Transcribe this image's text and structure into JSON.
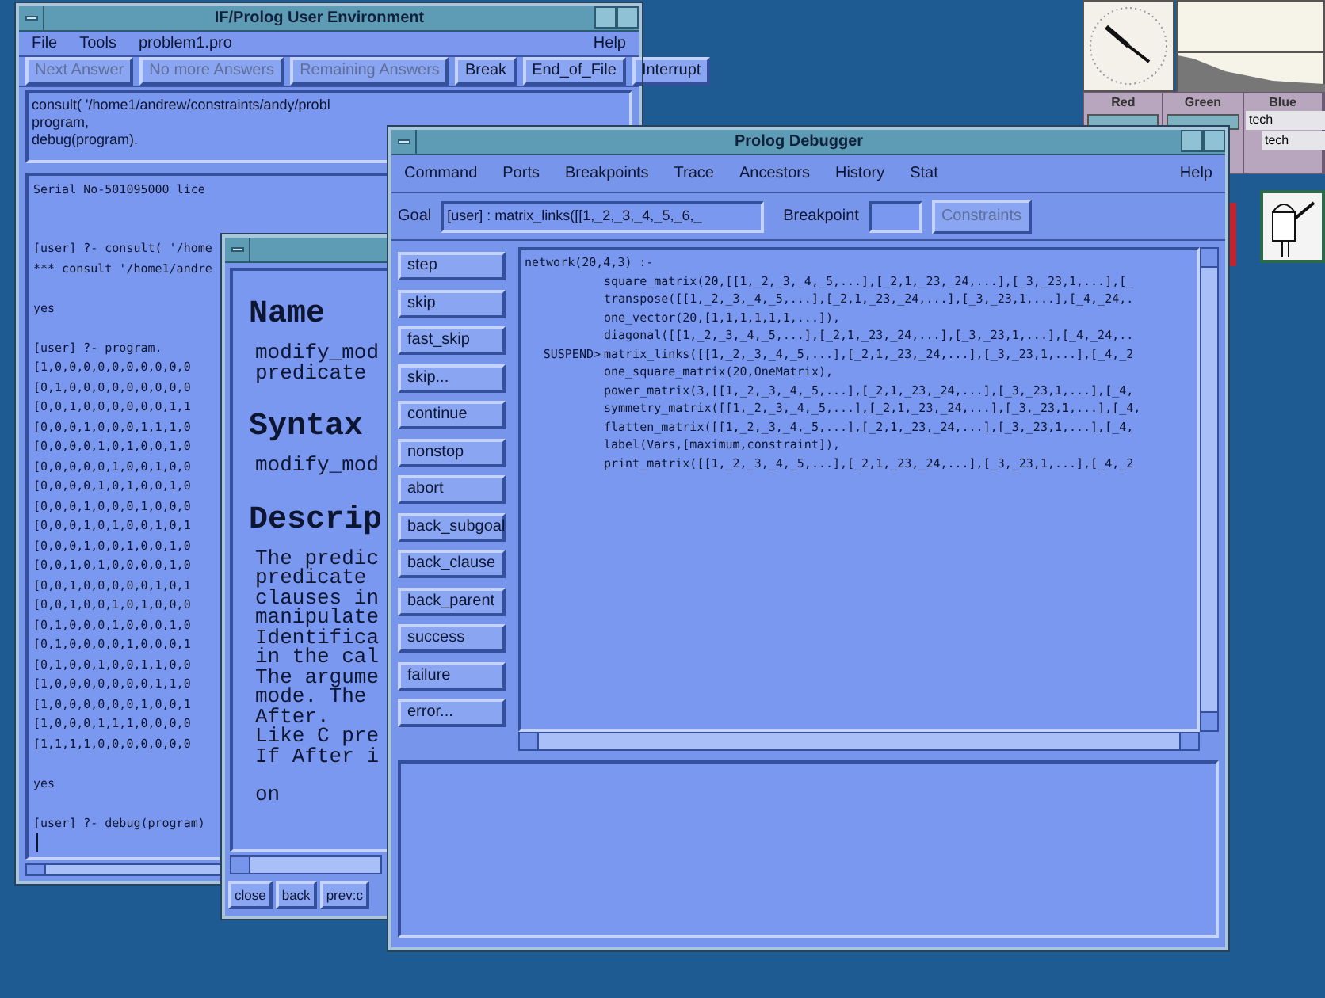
{
  "user_environment": {
    "title": "IF/Prolog User Environment",
    "menu": [
      "File",
      "Tools",
      "problem1.pro"
    ],
    "help_menu": "Help",
    "buttons": [
      {
        "label": "Next Answer",
        "disabled": true
      },
      {
        "label": "No more Answers",
        "disabled": true
      },
      {
        "label": "Remaining Answers",
        "disabled": true
      },
      {
        "label": "Break",
        "disabled": false
      },
      {
        "label": "End_of_File",
        "disabled": false
      },
      {
        "label": "Interrupt",
        "disabled": false
      }
    ],
    "query_lines": [
      "consult( '/home1/andrew/constraints/andy/probl",
      "program,",
      "debug(program)."
    ],
    "console_blocks": [
      [
        "Serial No-501095000 lice"
      ],
      [
        "[user] ?- consult( '/home",
        "*** consult '/home1/andre"
      ],
      [
        "yes"
      ],
      [
        "[user] ?- program.",
        "[1,0,0,0,0,0,0,0,0,0,0",
        "[0,1,0,0,0,0,0,0,0,0,0",
        "[0,0,1,0,0,0,0,0,0,1,1",
        "[0,0,0,1,0,0,0,1,1,1,0",
        "[0,0,0,0,1,0,1,0,0,1,0",
        "[0,0,0,0,0,1,0,0,1,0,0",
        "[0,0,0,0,1,0,1,0,0,1,0",
        "[0,0,0,1,0,0,0,1,0,0,0",
        "[0,0,0,1,0,1,0,0,1,0,1",
        "[0,0,0,1,0,0,1,0,0,1,0",
        "[0,0,1,0,1,0,0,0,0,1,0",
        "[0,0,1,0,0,0,0,0,1,0,1",
        "[0,0,1,0,0,1,0,1,0,0,0",
        "[0,1,0,0,0,1,0,0,0,1,0",
        "[0,1,0,0,0,0,1,0,0,0,1",
        "[0,1,0,0,1,0,0,1,1,0,0",
        "[1,0,0,0,0,0,0,0,1,1,0",
        "[1,0,0,0,0,0,0,1,0,0,1",
        "[1,0,0,0,1,1,1,0,0,0,0",
        "[1,1,1,1,0,0,0,0,0,0,0"
      ],
      [
        "yes"
      ],
      [
        "[user] ?- debug(program)"
      ]
    ]
  },
  "help_window": {
    "sections": [
      {
        "heading": "Name",
        "paragraphs": [
          [
            "modify_mod",
            "predicate"
          ]
        ]
      },
      {
        "heading": "Syntax",
        "paragraphs": [
          [
            "modify_mod"
          ]
        ]
      },
      {
        "heading": "Descrip",
        "paragraphs": [
          [
            "The predic",
            "predicate",
            "clauses in",
            "manipulate",
            "Identifica",
            "in the cal",
            "The argume",
            "mode. The",
            "After.",
            "Like C pre",
            "If After i"
          ],
          [
            "on"
          ]
        ]
      }
    ],
    "buttons": [
      "close",
      "back",
      "prev:c"
    ]
  },
  "debugger": {
    "title": "Prolog Debugger",
    "menu": [
      "Command",
      "Ports",
      "Breakpoints",
      "Trace",
      "Ancestors",
      "History",
      "Stat"
    ],
    "help_menu": "Help",
    "goal_label": "Goal",
    "goal": "[user] : matrix_links([[1,_2,_3,_4,_5,_6,_",
    "breakpoint_label": "Breakpoint",
    "constraints_button": {
      "label": "Constraints",
      "disabled": true
    },
    "commands": [
      "step",
      "skip",
      "fast_skip",
      "skip...",
      "continue",
      "nonstop",
      "abort",
      "back_subgoal",
      "back_clause",
      "back_parent",
      "success",
      "failure",
      "error..."
    ],
    "code_lines": [
      {
        "text": "network(20,4,3) :-"
      },
      {
        "text": "square_matrix(20,[[1,_2,_3,_4,_5,...],[_2,1,_23,_24,...],[_3,_23,1,...],[_"
      },
      {
        "text": "transpose([[1,_2,_3,_4,_5,...],[_2,1,_23,_24,...],[_3,_23,1,...],[_4,_24,."
      },
      {
        "text": "one_vector(20,[1,1,1,1,1,1,...]),"
      },
      {
        "text": "diagonal([[1,_2,_3,_4,_5,...],[_2,1,_23,_24,...],[_3,_23,1,...],[_4,_24,.."
      },
      {
        "text": "matrix_links([[1,_2,_3,_4,_5,...],[_2,1,_23,_24,...],[_3,_23,1,...],[_4,_2",
        "marker": "SUSPEND>"
      },
      {
        "text": "one_square_matrix(20,OneMatrix),"
      },
      {
        "text": "power_matrix(3,[[1,_2,_3,_4,_5,...],[_2,1,_23,_24,...],[_3,_23,1,...],[_4,"
      },
      {
        "text": "symmetry_matrix([[1,_2,_3,_4,_5,...],[_2,1,_23,_24,...],[_3,_23,1,...],[_4,"
      },
      {
        "text": "flatten_matrix([[1,_2,_3,_4,_5,...],[_2,1,_23,_24,...],[_3,_23,1,...],[_4,"
      },
      {
        "text": "label(Vars,[maximum,constraint]),"
      },
      {
        "text": "print_matrix([[1,_2,_3,_4,_5,...],[_2,1,_23,_24,...],[_3,_23,1,...],[_4,_2"
      }
    ]
  },
  "color_panel": {
    "columns": [
      "Red",
      "Green",
      "Blue"
    ],
    "items": [
      "tech",
      "tech"
    ]
  }
}
